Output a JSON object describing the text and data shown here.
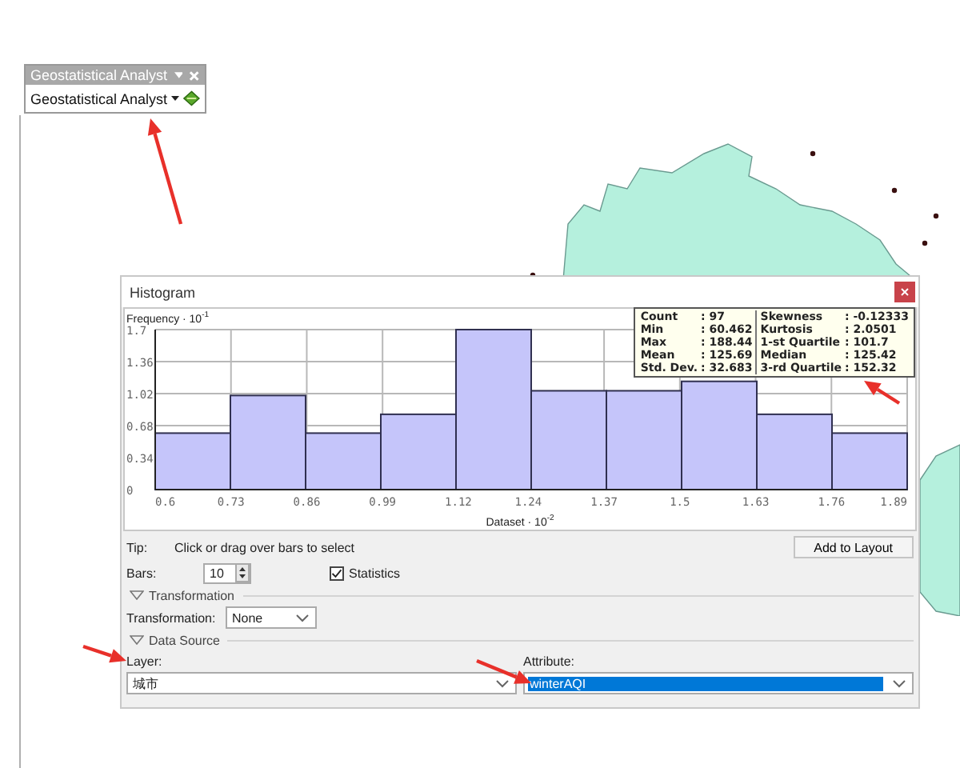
{
  "toolbar": {
    "title": "Geostatistical Analyst",
    "menu": {
      "label": "Geostatistical Analyst"
    }
  },
  "histogram": {
    "title": "Histogram",
    "chart_data": {
      "type": "bar",
      "ylabel": "Frequency · 10$^{-1}$",
      "xlabel": "Dataset · 10$^{-2}$",
      "x": [
        0.6645,
        0.7935,
        0.9225,
        1.0515,
        1.1805,
        1.3095,
        1.4385,
        1.5675,
        1.6965,
        1.8255
      ],
      "values": [
        0.6,
        1.0,
        0.6,
        0.8,
        1.7,
        1.05,
        1.05,
        1.15,
        0.8,
        0.6
      ],
      "grid": true,
      "xlim": [
        0.6,
        1.89
      ],
      "ylim": [
        0,
        1.7
      ],
      "xticks": [
        0.6,
        0.73,
        0.86,
        0.99,
        1.12,
        1.24,
        1.37,
        1.5,
        1.63,
        1.76,
        1.89
      ],
      "yticks": [
        0,
        0.34,
        0.68,
        1.02,
        1.36,
        1.7
      ]
    },
    "statistics": [
      [
        {
          "label": "Count",
          "value": ": 97"
        },
        {
          "label": "Min",
          "value": ": 60.462"
        },
        {
          "label": "Max",
          "value": ": 188.44"
        },
        {
          "label": "Mean",
          "value": ": 125.69"
        },
        {
          "label": "Std. Dev.",
          "value": ": 32.683"
        }
      ],
      [
        {
          "label": "Skewness",
          "value": ": -0.12333"
        },
        {
          "label": "Kurtosis",
          "value": ": 2.0501"
        },
        {
          "label": "1-st Quartile",
          "value": ": 101.7"
        },
        {
          "label": "Median",
          "value": ": 125.42"
        },
        {
          "label": "3-rd Quartile",
          "value": ": 152.32"
        }
      ]
    ],
    "tip": {
      "label": "Tip:",
      "text": "Click or drag over bars to select"
    },
    "add_button": "Add to Layout",
    "bars": {
      "label": "Bars:",
      "value": "10"
    },
    "statistics_option": {
      "label": "Statistics",
      "checked": true
    },
    "transformation_group": "Transformation",
    "transformation": {
      "label": "Transformation:",
      "value": "None"
    },
    "data_source_group": "Data Source",
    "layer": {
      "label": "Layer:",
      "value": "城市"
    },
    "attribute": {
      "label": "Attribute:",
      "value": "winterAQI",
      "selected": true
    }
  }
}
